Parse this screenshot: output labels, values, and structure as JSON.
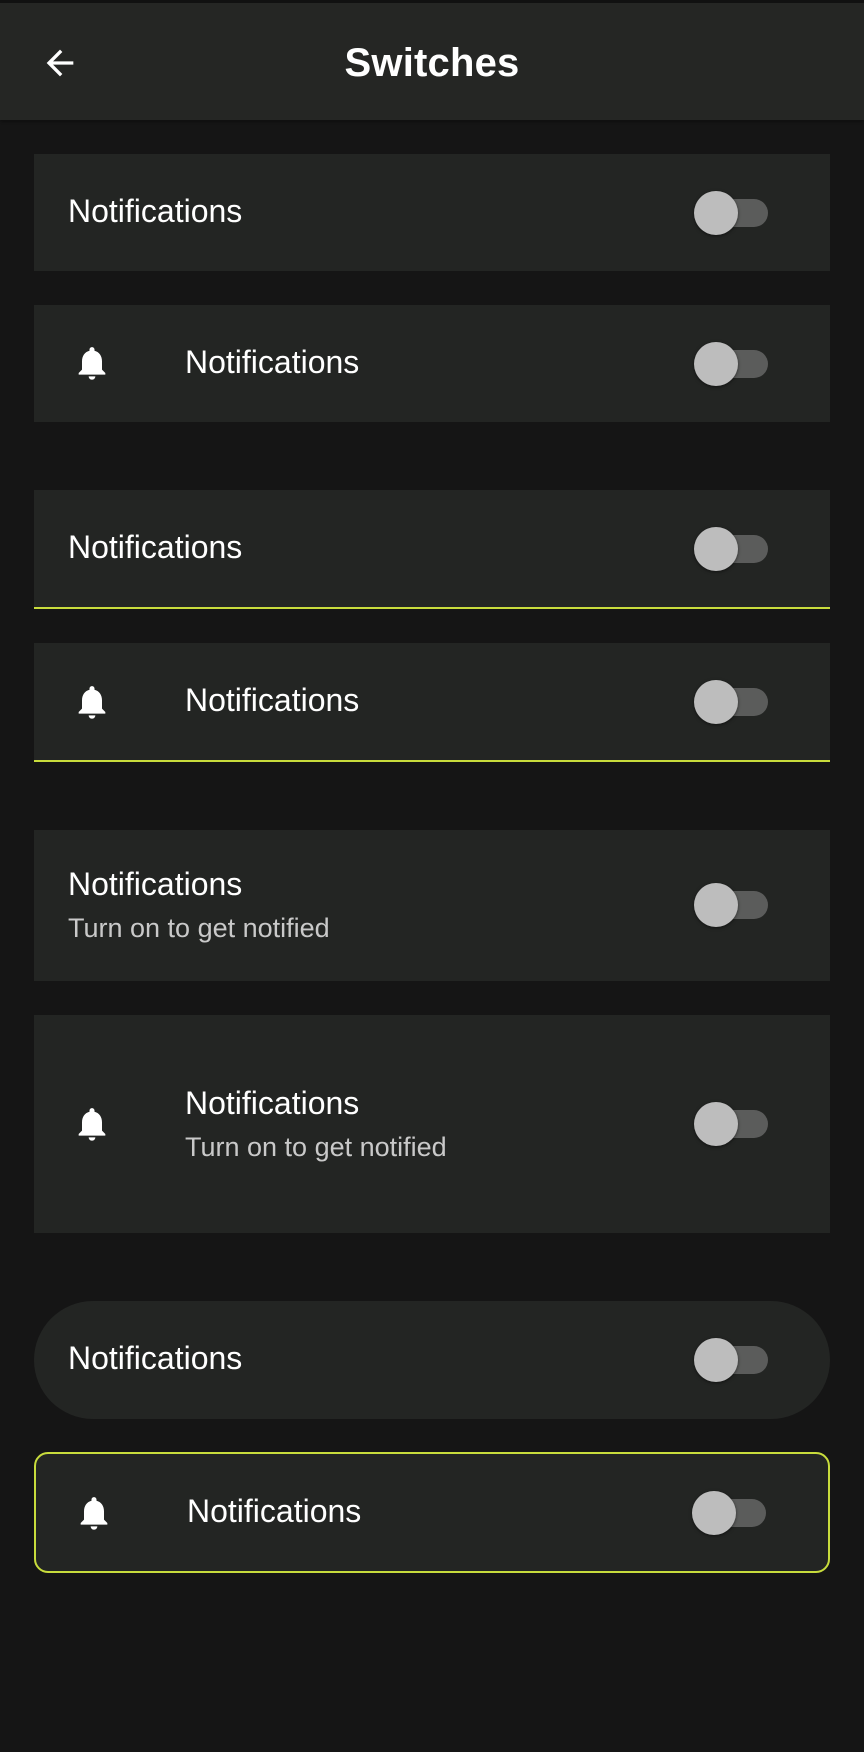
{
  "app_bar": {
    "title": "Switches",
    "back_icon": "arrow-left-icon"
  },
  "tiles": [
    {
      "title": "Notifications",
      "switch_on": false
    },
    {
      "title": "Notifications",
      "icon": "bell-icon",
      "switch_on": false
    },
    {
      "title": "Notifications",
      "switch_on": false
    },
    {
      "title": "Notifications",
      "icon": "bell-icon",
      "switch_on": false
    },
    {
      "title": "Notifications",
      "subtitle": "Turn on to get notified",
      "switch_on": false
    },
    {
      "title": "Notifications",
      "subtitle": "Turn on to get notified",
      "icon": "bell-icon",
      "switch_on": false
    },
    {
      "title": "Notifications",
      "switch_on": false
    },
    {
      "title": "Notifications",
      "icon": "bell-icon",
      "switch_on": false
    }
  ],
  "colors": {
    "background": "#151515",
    "surface": "#232523",
    "accent": "#c8dc3c",
    "switch_thumb_off": "#bdbdbd",
    "switch_track_off": "#5b5c5b"
  }
}
